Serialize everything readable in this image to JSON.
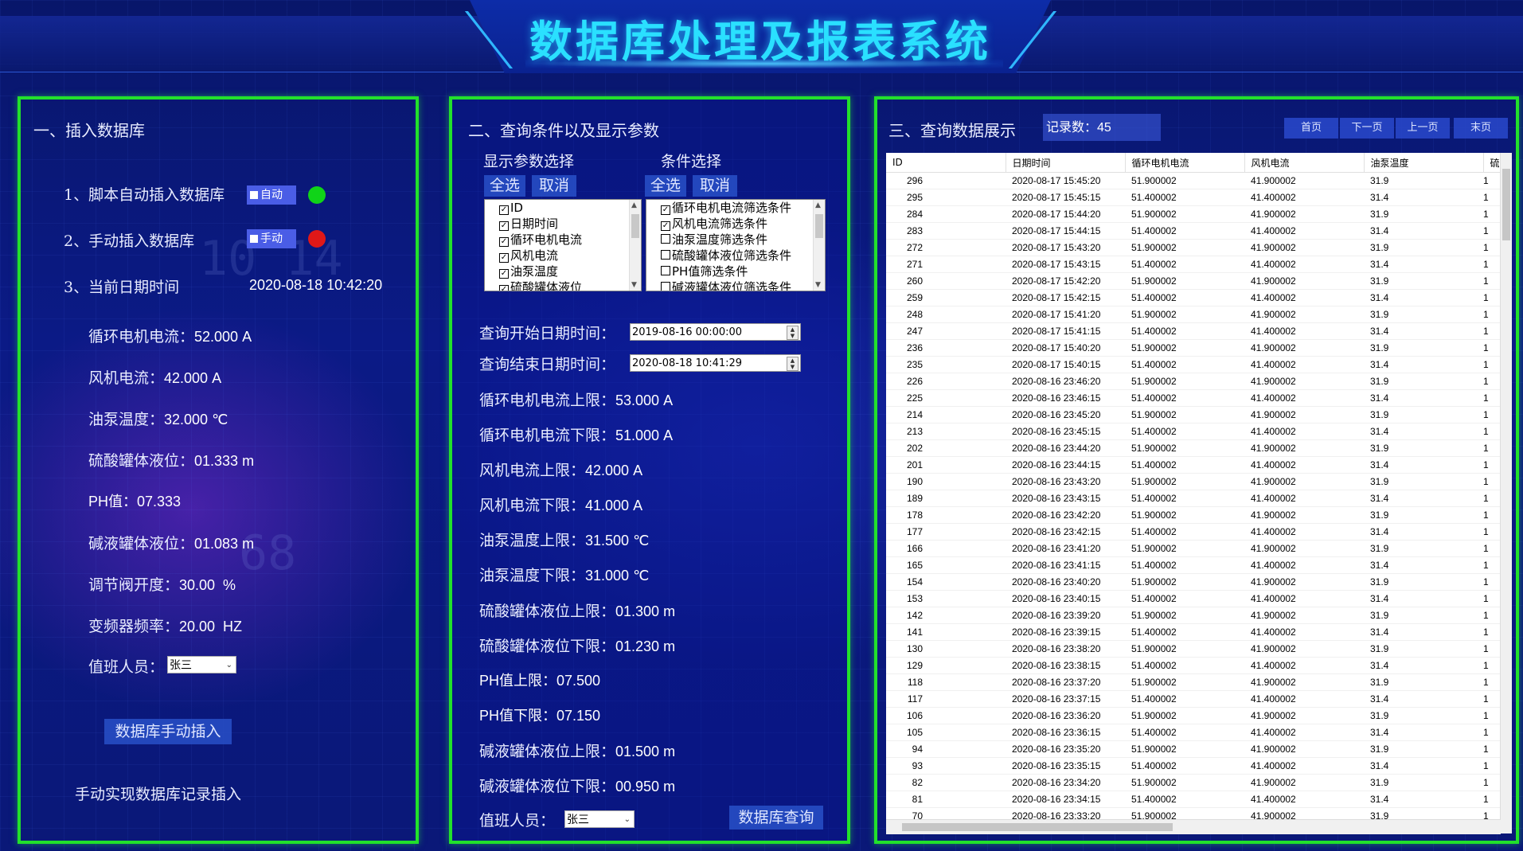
{
  "app": {
    "title": "数据库处理及报表系统"
  },
  "panel1": {
    "title": "一、插入数据库",
    "auto_insert": {
      "label": "1、脚本自动插入数据库",
      "button": "自动",
      "led_color": "#10d418"
    },
    "manual_insert": {
      "label": "2、手动插入数据库",
      "button": "手动",
      "led_color": "#e01818"
    },
    "datetime": {
      "label": "3、当前日期时间",
      "value": "2020-08-18 10:42:20"
    },
    "readings": [
      {
        "label": "循环电机电流：",
        "value": "52.000 A"
      },
      {
        "label": "风机电流：",
        "value": "42.000 A"
      },
      {
        "label": "油泵温度：",
        "value": "32.000 ℃"
      },
      {
        "label": "硫酸罐体液位：",
        "value": "01.333 m"
      },
      {
        "label": "PH值：",
        "value": "07.333"
      },
      {
        "label": "碱液罐体液位：",
        "value": "01.083 m"
      },
      {
        "label": "调节阀开度：",
        "value": "30.00  %"
      },
      {
        "label": "变频器频率：",
        "value": "20.00  HZ"
      }
    ],
    "duty": {
      "label": "值班人员：",
      "value": "张三"
    },
    "manual_button": "数据库手动插入",
    "note": "手动实现数据库记录插入"
  },
  "panel2": {
    "title": "二、查询条件以及显示参数",
    "display_title": "显示参数选择",
    "cond_title": "条件选择",
    "select_all": "全选",
    "cancel": "取消",
    "display_items": [
      "ID",
      "日期时间",
      "循环电机电流",
      "风机电流",
      "油泵温度",
      "硫酸罐体液位"
    ],
    "cond_items": [
      {
        "label": "循环电机电流筛选条件",
        "checked": true
      },
      {
        "label": "风机电流筛选条件",
        "checked": true
      },
      {
        "label": "油泵温度筛选条件",
        "checked": false
      },
      {
        "label": "硫酸罐体液位筛选条件",
        "checked": false
      },
      {
        "label": "PH值筛选条件",
        "checked": false
      },
      {
        "label": "碱液罐体液位筛选条件",
        "checked": false
      }
    ],
    "start": {
      "label": "查询开始日期时间：",
      "value": "2019-08-16 00:00:00"
    },
    "end": {
      "label": "查询结束日期时间：",
      "value": "2020-08-18 10:41:29"
    },
    "limits": [
      {
        "label": "循环电机电流上限：",
        "value": "53.000 A"
      },
      {
        "label": "循环电机电流下限：",
        "value": "51.000 A"
      },
      {
        "label": "风机电流上限：",
        "value": "42.000 A"
      },
      {
        "label": "风机电流下限：",
        "value": "41.000 A"
      },
      {
        "label": "油泵温度上限：",
        "value": "31.500 ℃"
      },
      {
        "label": "油泵温度下限：",
        "value": "31.000 ℃"
      },
      {
        "label": "硫酸罐体液位上限：",
        "value": "01.300 m"
      },
      {
        "label": "硫酸罐体液位下限：",
        "value": "01.230 m"
      },
      {
        "label": "PH值上限：",
        "value": "07.500"
      },
      {
        "label": "PH值下限：",
        "value": "07.150"
      },
      {
        "label": "碱液罐体液位上限：",
        "value": "01.500 m"
      },
      {
        "label": "碱液罐体液位下限：",
        "value": "00.950 m"
      }
    ],
    "duty": {
      "label": "值班人员：",
      "value": "张三"
    },
    "query_button": "数据库查询"
  },
  "panel3": {
    "title": "三、查询数据展示",
    "count_label": "记录数：",
    "count_value": "45",
    "pager": [
      "首页",
      "下一页",
      "上一页",
      "末页"
    ],
    "columns": [
      "ID",
      "日期时间",
      "循环电机电流",
      "风机电流",
      "油泵温度",
      "硫"
    ],
    "rows": [
      [
        "296",
        "2020-08-17 15:45:20",
        "51.900002",
        "41.900002",
        "31.9",
        "1"
      ],
      [
        "295",
        "2020-08-17 15:45:15",
        "51.400002",
        "41.400002",
        "31.4",
        "1"
      ],
      [
        "284",
        "2020-08-17 15:44:20",
        "51.900002",
        "41.900002",
        "31.9",
        "1"
      ],
      [
        "283",
        "2020-08-17 15:44:15",
        "51.400002",
        "41.400002",
        "31.4",
        "1"
      ],
      [
        "272",
        "2020-08-17 15:43:20",
        "51.900002",
        "41.900002",
        "31.9",
        "1"
      ],
      [
        "271",
        "2020-08-17 15:43:15",
        "51.400002",
        "41.400002",
        "31.4",
        "1"
      ],
      [
        "260",
        "2020-08-17 15:42:20",
        "51.900002",
        "41.900002",
        "31.9",
        "1"
      ],
      [
        "259",
        "2020-08-17 15:42:15",
        "51.400002",
        "41.400002",
        "31.4",
        "1"
      ],
      [
        "248",
        "2020-08-17 15:41:20",
        "51.900002",
        "41.900002",
        "31.9",
        "1"
      ],
      [
        "247",
        "2020-08-17 15:41:15",
        "51.400002",
        "41.400002",
        "31.4",
        "1"
      ],
      [
        "236",
        "2020-08-17 15:40:20",
        "51.900002",
        "41.900002",
        "31.9",
        "1"
      ],
      [
        "235",
        "2020-08-17 15:40:15",
        "51.400002",
        "41.400002",
        "31.4",
        "1"
      ],
      [
        "226",
        "2020-08-16 23:46:20",
        "51.900002",
        "41.900002",
        "31.9",
        "1"
      ],
      [
        "225",
        "2020-08-16 23:46:15",
        "51.400002",
        "41.400002",
        "31.4",
        "1"
      ],
      [
        "214",
        "2020-08-16 23:45:20",
        "51.900002",
        "41.900002",
        "31.9",
        "1"
      ],
      [
        "213",
        "2020-08-16 23:45:15",
        "51.400002",
        "41.400002",
        "31.4",
        "1"
      ],
      [
        "202",
        "2020-08-16 23:44:20",
        "51.900002",
        "41.900002",
        "31.9",
        "1"
      ],
      [
        "201",
        "2020-08-16 23:44:15",
        "51.400002",
        "41.400002",
        "31.4",
        "1"
      ],
      [
        "190",
        "2020-08-16 23:43:20",
        "51.900002",
        "41.900002",
        "31.9",
        "1"
      ],
      [
        "189",
        "2020-08-16 23:43:15",
        "51.400002",
        "41.400002",
        "31.4",
        "1"
      ],
      [
        "178",
        "2020-08-16 23:42:20",
        "51.900002",
        "41.900002",
        "31.9",
        "1"
      ],
      [
        "177",
        "2020-08-16 23:42:15",
        "51.400002",
        "41.400002",
        "31.4",
        "1"
      ],
      [
        "166",
        "2020-08-16 23:41:20",
        "51.900002",
        "41.900002",
        "31.9",
        "1"
      ],
      [
        "165",
        "2020-08-16 23:41:15",
        "51.400002",
        "41.400002",
        "31.4",
        "1"
      ],
      [
        "154",
        "2020-08-16 23:40:20",
        "51.900002",
        "41.900002",
        "31.9",
        "1"
      ],
      [
        "153",
        "2020-08-16 23:40:15",
        "51.400002",
        "41.400002",
        "31.4",
        "1"
      ],
      [
        "142",
        "2020-08-16 23:39:20",
        "51.900002",
        "41.900002",
        "31.9",
        "1"
      ],
      [
        "141",
        "2020-08-16 23:39:15",
        "51.400002",
        "41.400002",
        "31.4",
        "1"
      ],
      [
        "130",
        "2020-08-16 23:38:20",
        "51.900002",
        "41.900002",
        "31.9",
        "1"
      ],
      [
        "129",
        "2020-08-16 23:38:15",
        "51.400002",
        "41.400002",
        "31.4",
        "1"
      ],
      [
        "118",
        "2020-08-16 23:37:20",
        "51.900002",
        "41.900002",
        "31.9",
        "1"
      ],
      [
        "117",
        "2020-08-16 23:37:15",
        "51.400002",
        "41.400002",
        "31.4",
        "1"
      ],
      [
        "106",
        "2020-08-16 23:36:20",
        "51.900002",
        "41.900002",
        "31.9",
        "1"
      ],
      [
        "105",
        "2020-08-16 23:36:15",
        "51.400002",
        "41.400002",
        "31.4",
        "1"
      ],
      [
        "94",
        "2020-08-16 23:35:20",
        "51.900002",
        "41.900002",
        "31.9",
        "1"
      ],
      [
        "93",
        "2020-08-16 23:35:15",
        "51.400002",
        "41.400002",
        "31.4",
        "1"
      ],
      [
        "82",
        "2020-08-16 23:34:20",
        "51.900002",
        "41.900002",
        "31.9",
        "1"
      ],
      [
        "81",
        "2020-08-16 23:34:15",
        "51.400002",
        "41.400002",
        "31.4",
        "1"
      ],
      [
        "70",
        "2020-08-16 23:33:20",
        "51.900002",
        "41.900002",
        "31.9",
        "1"
      ]
    ]
  }
}
